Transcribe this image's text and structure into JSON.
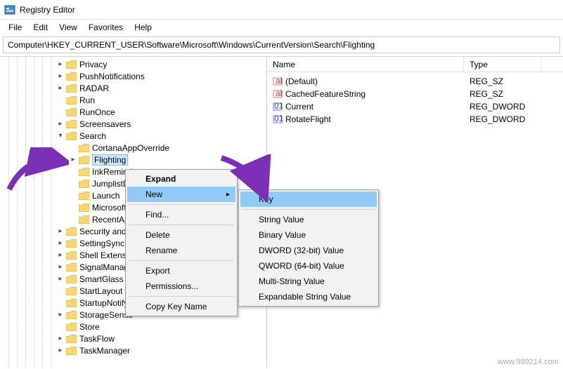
{
  "window": {
    "title": "Registry Editor"
  },
  "menubar": {
    "items": [
      "File",
      "Edit",
      "View",
      "Favorites",
      "Help"
    ]
  },
  "addressbar": {
    "path": "Computer\\HKEY_CURRENT_USER\\Software\\Microsoft\\Windows\\CurrentVersion\\Search\\Flighting"
  },
  "tree": {
    "indent_base": 55,
    "nodes": [
      {
        "label": "Privacy",
        "indent": 80,
        "toggle": ">"
      },
      {
        "label": "PushNotifications",
        "indent": 80,
        "toggle": ">"
      },
      {
        "label": "RADAR",
        "indent": 80,
        "toggle": ">"
      },
      {
        "label": "Run",
        "indent": 80,
        "toggle": ""
      },
      {
        "label": "RunOnce",
        "indent": 80,
        "toggle": ""
      },
      {
        "label": "Screensavers",
        "indent": 80,
        "toggle": ">"
      },
      {
        "label": "Search",
        "indent": 80,
        "toggle": "v"
      },
      {
        "label": "CortanaAppOverride",
        "indent": 98,
        "toggle": ""
      },
      {
        "label": "Flighting",
        "indent": 98,
        "toggle": ">",
        "selected": true
      },
      {
        "label": "InkReminder",
        "indent": 98,
        "toggle": ""
      },
      {
        "label": "JumplistData",
        "indent": 98,
        "toggle": ""
      },
      {
        "label": "Launch",
        "indent": 98,
        "toggle": ""
      },
      {
        "label": "Microsoft",
        "indent": 98,
        "toggle": ""
      },
      {
        "label": "RecentApps",
        "indent": 98,
        "toggle": ""
      },
      {
        "label": "Security and Maintenance",
        "indent": 80,
        "toggle": ">"
      },
      {
        "label": "SettingSync",
        "indent": 80,
        "toggle": ">"
      },
      {
        "label": "Shell Extensions",
        "indent": 80,
        "toggle": ">"
      },
      {
        "label": "SignalManager",
        "indent": 80,
        "toggle": ">"
      },
      {
        "label": "SmartGlass",
        "indent": 80,
        "toggle": ">"
      },
      {
        "label": "StartLayout",
        "indent": 80,
        "toggle": ""
      },
      {
        "label": "StartupNotify",
        "indent": 80,
        "toggle": ""
      },
      {
        "label": "StorageSense",
        "indent": 80,
        "toggle": ">"
      },
      {
        "label": "Store",
        "indent": 80,
        "toggle": ""
      },
      {
        "label": "TaskFlow",
        "indent": 80,
        "toggle": ">"
      },
      {
        "label": "TaskManager",
        "indent": 80,
        "toggle": ">"
      }
    ]
  },
  "list": {
    "columns": [
      "Name",
      "Type"
    ],
    "rows": [
      {
        "name": "(Default)",
        "type": "REG_SZ",
        "icon": "string"
      },
      {
        "name": "CachedFeatureString",
        "type": "REG_SZ",
        "icon": "string"
      },
      {
        "name": "Current",
        "type": "REG_DWORD",
        "icon": "dword"
      },
      {
        "name": "RotateFlight",
        "type": "REG_DWORD",
        "icon": "dword"
      }
    ]
  },
  "context_menu": {
    "items": [
      {
        "label": "Expand",
        "bold": true
      },
      {
        "label": "New",
        "submenu": true,
        "highlight": true
      },
      {
        "sep": true
      },
      {
        "label": "Find..."
      },
      {
        "sep": true
      },
      {
        "label": "Delete"
      },
      {
        "label": "Rename"
      },
      {
        "sep": true
      },
      {
        "label": "Export"
      },
      {
        "label": "Permissions..."
      },
      {
        "sep": true
      },
      {
        "label": "Copy Key Name"
      }
    ]
  },
  "submenu": {
    "items": [
      {
        "label": "Key",
        "highlight": true
      },
      {
        "sep": true
      },
      {
        "label": "String Value"
      },
      {
        "label": "Binary Value"
      },
      {
        "label": "DWORD (32-bit) Value"
      },
      {
        "label": "QWORD (64-bit) Value"
      },
      {
        "label": "Multi-String Value"
      },
      {
        "label": "Expandable String Value"
      }
    ]
  },
  "watermark": {
    "text": "www.989214.com"
  }
}
